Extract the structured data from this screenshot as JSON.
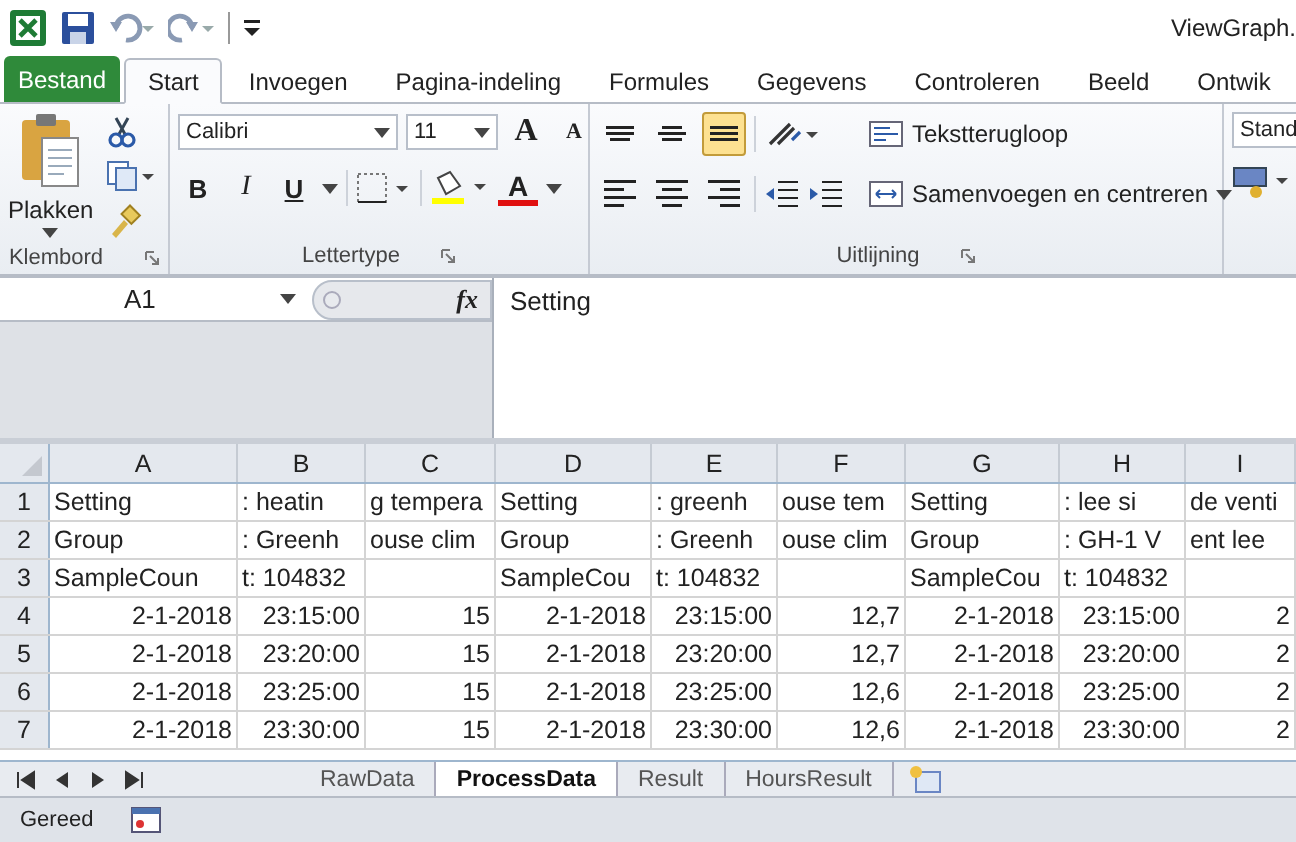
{
  "window": {
    "title": "ViewGraph."
  },
  "ribbon_tabs": [
    {
      "label": "Bestand",
      "kind": "file",
      "selected": false
    },
    {
      "label": "Start",
      "kind": "tab",
      "selected": true
    },
    {
      "label": "Invoegen",
      "kind": "tab",
      "selected": false
    },
    {
      "label": "Pagina-indeling",
      "kind": "tab",
      "selected": false
    },
    {
      "label": "Formules",
      "kind": "tab",
      "selected": false
    },
    {
      "label": "Gegevens",
      "kind": "tab",
      "selected": false
    },
    {
      "label": "Controleren",
      "kind": "tab",
      "selected": false
    },
    {
      "label": "Beeld",
      "kind": "tab",
      "selected": false
    },
    {
      "label": "Ontwik",
      "kind": "tab",
      "selected": false
    }
  ],
  "clipboard": {
    "paste": "Plakken",
    "group": "Klembord"
  },
  "font": {
    "name": "Calibri",
    "size": "11",
    "grow": "A",
    "shrink": "A",
    "bold": "B",
    "italic": "I",
    "underline": "U",
    "font_color_glyph": "A",
    "group": "Lettertype"
  },
  "alignment": {
    "vertical": [
      {
        "kind": "top",
        "selected": false
      },
      {
        "kind": "middle",
        "selected": false
      },
      {
        "kind": "bottom",
        "selected": true
      }
    ],
    "horizontal": [
      {
        "kind": "left",
        "selected": false
      },
      {
        "kind": "center",
        "selected": false
      },
      {
        "kind": "right",
        "selected": false
      }
    ],
    "wrap": "Tekstterugloop",
    "merge": "Samenvoegen en centreren",
    "group": "Uitlijning"
  },
  "number": {
    "format": "Stand"
  },
  "formula_bar": {
    "name_box": "A1",
    "fx": "fx",
    "value": "Setting"
  },
  "columns": [
    "A",
    "B",
    "C",
    "D",
    "E",
    "F",
    "G",
    "H",
    "I"
  ],
  "rows": [
    {
      "number": "1",
      "cells": [
        "Setting",
        ": heatin",
        "g tempera",
        "Setting",
        ": greenh",
        "ouse tem",
        "Setting",
        ": lee si",
        "de venti"
      ]
    },
    {
      "number": "2",
      "cells": [
        "Group",
        ": Greenh",
        "ouse clim",
        "Group",
        ": Greenh",
        "ouse clim",
        "Group",
        ": GH-1 V",
        "ent lee"
      ]
    },
    {
      "number": "3",
      "cells": [
        "SampleCoun",
        "t: 104832",
        "",
        "SampleCou",
        "t: 104832",
        "",
        "SampleCou",
        "t: 104832",
        ""
      ]
    },
    {
      "number": "4",
      "cells": [
        "2-1-2018",
        "23:15:00",
        "15",
        "2-1-2018",
        "23:15:00",
        "12,7",
        "2-1-2018",
        "23:15:00",
        "2"
      ]
    },
    {
      "number": "5",
      "cells": [
        "2-1-2018",
        "23:20:00",
        "15",
        "2-1-2018",
        "23:20:00",
        "12,7",
        "2-1-2018",
        "23:20:00",
        "2"
      ]
    },
    {
      "number": "6",
      "cells": [
        "2-1-2018",
        "23:25:00",
        "15",
        "2-1-2018",
        "23:25:00",
        "12,6",
        "2-1-2018",
        "23:25:00",
        "2"
      ]
    },
    {
      "number": "7",
      "cells": [
        "2-1-2018",
        "23:30:00",
        "15",
        "2-1-2018",
        "23:30:00",
        "12,6",
        "2-1-2018",
        "23:30:00",
        "2"
      ]
    }
  ],
  "sheet_tabs": [
    {
      "label": "RawData",
      "selected": false
    },
    {
      "label": "ProcessData",
      "selected": true
    },
    {
      "label": "Result",
      "selected": false
    },
    {
      "label": "HoursResult",
      "selected": false
    }
  ],
  "status_bar": {
    "text": "Gereed"
  }
}
